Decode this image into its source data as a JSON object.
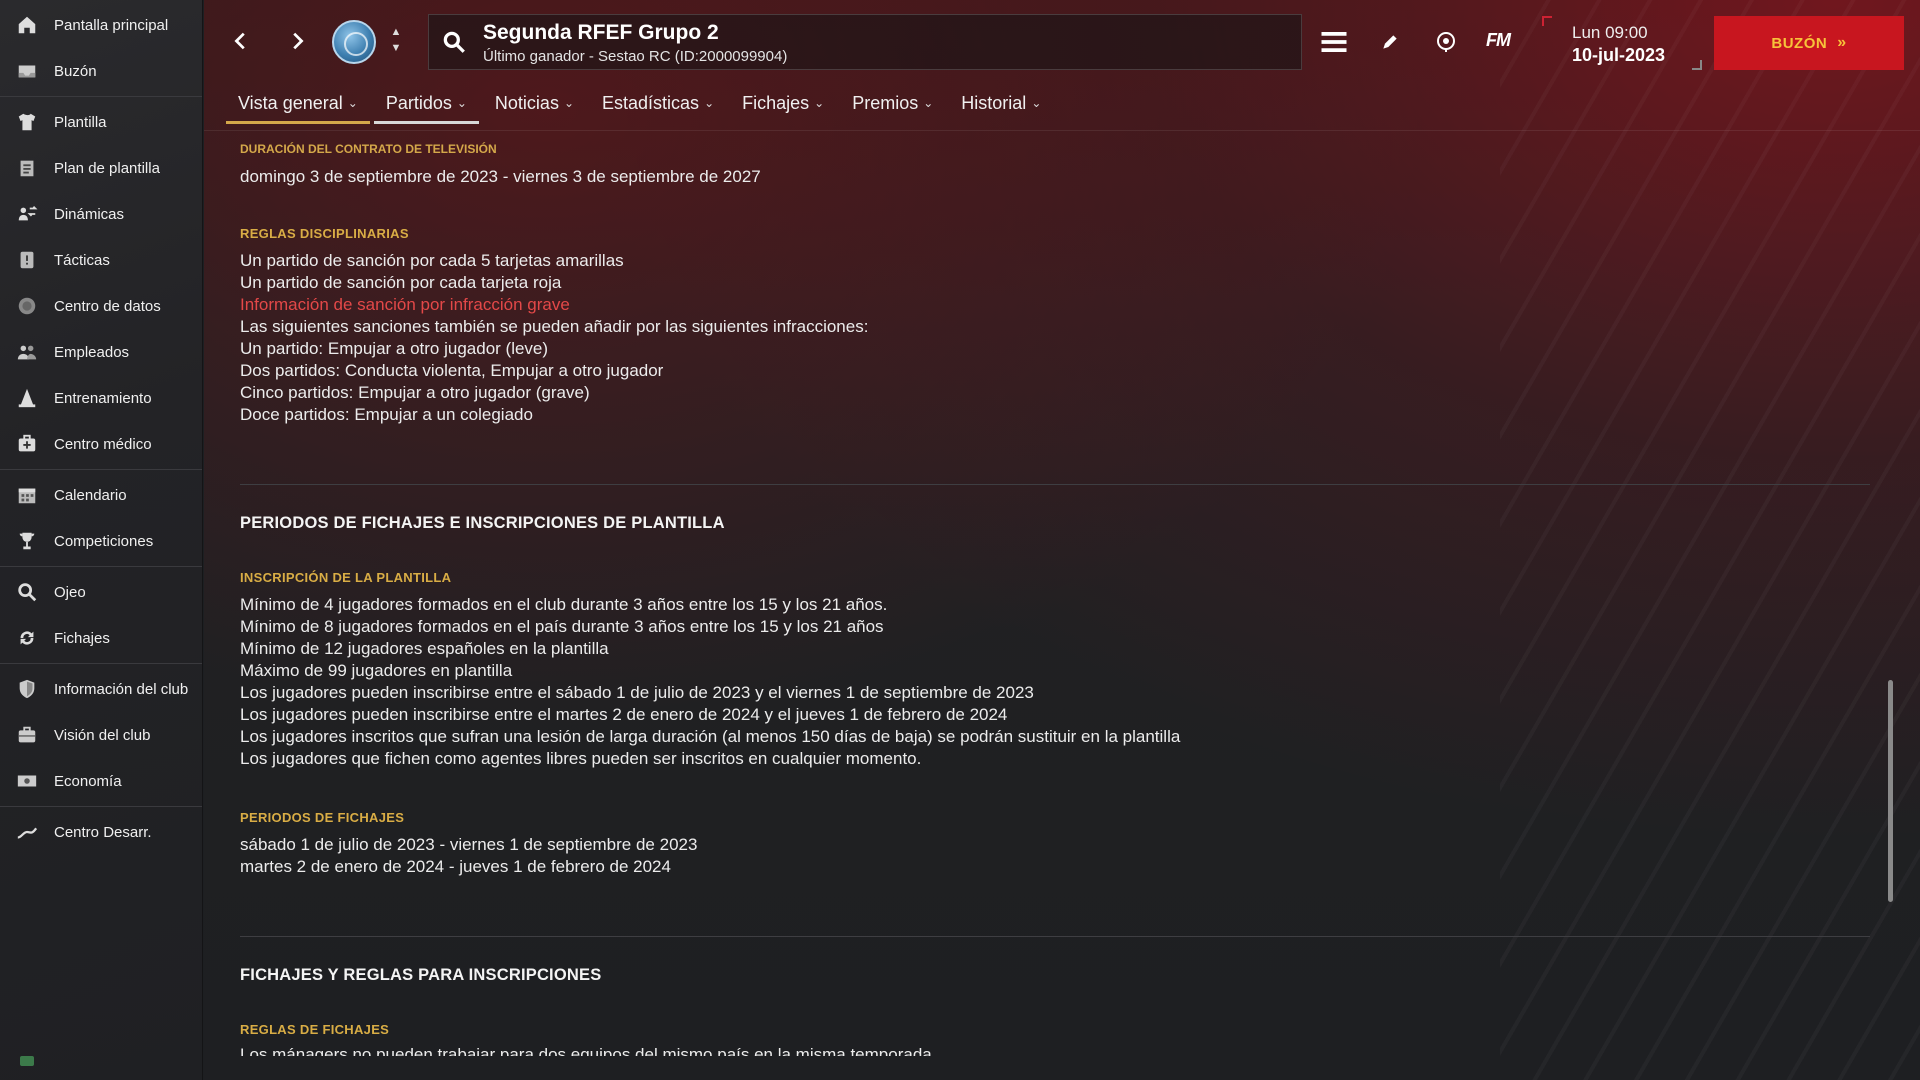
{
  "sidebar": {
    "groups": [
      [
        {
          "label": "Pantalla principal",
          "icon": "home-icon"
        },
        {
          "label": "Buzón",
          "icon": "inbox-icon"
        }
      ],
      [
        {
          "label": "Plantilla",
          "icon": "shirt-icon"
        },
        {
          "label": "Plan de plantilla",
          "icon": "clipboard-icon"
        },
        {
          "label": "Dinámicas",
          "icon": "dynamics-icon"
        },
        {
          "label": "Tácticas",
          "icon": "tactics-board-icon"
        },
        {
          "label": "Centro de datos",
          "icon": "data-hub-icon"
        },
        {
          "label": "Empleados",
          "icon": "staff-icon"
        },
        {
          "label": "Entrenamiento",
          "icon": "cone-icon"
        },
        {
          "label": "Centro médico",
          "icon": "medical-kit-icon"
        }
      ],
      [
        {
          "label": "Calendario",
          "icon": "calendar-icon"
        },
        {
          "label": "Competiciones",
          "icon": "trophy-icon"
        }
      ],
      [
        {
          "label": "Ojeo",
          "icon": "magnifier-icon"
        },
        {
          "label": "Fichajes",
          "icon": "transfer-arrows-icon"
        }
      ],
      [
        {
          "label": "Información del club",
          "icon": "shield-icon"
        },
        {
          "label": "Visión del club",
          "icon": "briefcase-icon"
        },
        {
          "label": "Economía",
          "icon": "money-icon"
        }
      ],
      [
        {
          "label": "Centro Desarr.",
          "icon": "trend-line-icon"
        }
      ]
    ]
  },
  "header": {
    "title": "Segunda RFEF Grupo 2",
    "subtitle": "Último ganador - Sestao RC (ID:2000099904)",
    "fm_logo": "FM",
    "day_time": "Lun 09:00",
    "date": "10-jul-2023",
    "inbox_button": "BUZÓN"
  },
  "tabs": [
    {
      "label": "Vista general",
      "active": true
    },
    {
      "label": "Partidos",
      "active": true
    },
    {
      "label": "Noticias",
      "active": false
    },
    {
      "label": "Estadísticas",
      "active": false
    },
    {
      "label": "Fichajes",
      "active": false
    },
    {
      "label": "Premios",
      "active": false
    },
    {
      "label": "Historial",
      "active": false
    }
  ],
  "content": {
    "tv_contract": {
      "label": "DURACIÓN DEL CONTRATO DE TELEVISIÓN",
      "value": "domingo 3 de septiembre de 2023 - viernes 3 de septiembre de 2027"
    },
    "disciplinary": {
      "label": "REGLAS DISCIPLINARIAS",
      "lines": [
        "Un partido de sanción por cada 5 tarjetas amarillas",
        "Un partido de sanción por cada tarjeta roja"
      ],
      "link": "Información de sanción por infracción grave",
      "extra_lines": [
        "Las siguientes sanciones también se pueden añadir por las siguientes infracciones:",
        "Un partido: Empujar a otro jugador (leve)",
        "Dos partidos: Conducta violenta, Empujar a otro jugador",
        "Cinco partidos: Empujar a otro jugador (grave)",
        "Doce partidos: Empujar a un colegiado"
      ]
    },
    "transfer_periods_section": {
      "heading": "PERIODOS DE FICHAJES E INSCRIPCIONES DE PLANTILLA",
      "registration": {
        "label": "INSCRIPCIÓN DE LA PLANTILLA",
        "lines": [
          "Mínimo de 4 jugadores formados en el club durante 3 años entre los 15 y los 21 años.",
          "Mínimo de 8 jugadores formados en el país durante 3 años entre los 15 y los 21 años",
          "Mínimo de 12 jugadores españoles en la plantilla",
          "Máximo de 99 jugadores en plantilla",
          "Los jugadores pueden inscribirse entre el sábado 1 de julio de 2023 y el viernes 1 de septiembre de 2023",
          "Los jugadores pueden inscribirse entre el martes 2 de enero de 2024 y el jueves 1 de febrero de 2024",
          "Los jugadores inscritos que sufran una lesión de larga duración (al menos 150 días de baja) se podrán sustituir en la plantilla",
          "Los jugadores que fichen como agentes libres pueden ser inscritos en cualquier momento."
        ]
      },
      "windows": {
        "label": "PERIODOS DE FICHAJES",
        "lines": [
          "sábado 1 de julio de 2023 - viernes 1 de septiembre de 2023",
          "martes 2 de enero de 2024 - jueves 1 de febrero de 2024"
        ]
      }
    },
    "transfer_rules_section": {
      "heading": "FICHAJES Y REGLAS PARA INSCRIPCIONES",
      "rules": {
        "label": "REGLAS DE FICHAJES",
        "first_line": "Los mánagers no pueden trabajar para dos equipos del mismo país en la misma temporada"
      }
    }
  },
  "colors": {
    "accent_gold": "#d9ad45",
    "inbox_red": "#c8161f",
    "inbox_text": "#f7c33a",
    "link_red": "#e34848"
  }
}
